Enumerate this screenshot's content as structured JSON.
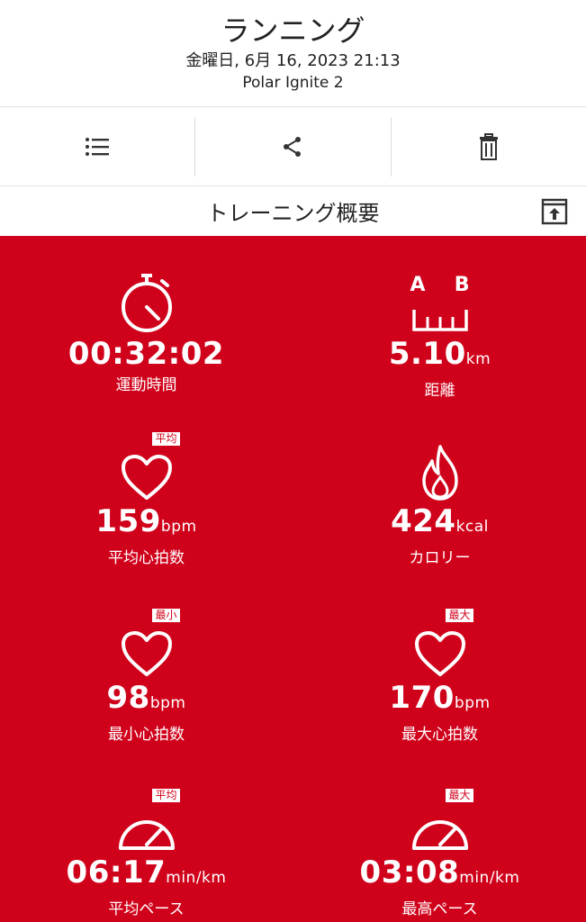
{
  "header": {
    "title": "ランニング",
    "subtitle": "金曜日, 6月 16, 2023 21:13",
    "device": "Polar Ignite 2"
  },
  "toolbar": {
    "icons": [
      "list-icon",
      "share-icon",
      "trash-icon"
    ]
  },
  "section": {
    "title": "トレーニング概要",
    "export_icon": "export-icon"
  },
  "stats": {
    "duration": {
      "value": "00:32:02",
      "unit": "",
      "label": "運動時間"
    },
    "distance": {
      "value": "5.10",
      "unit": "km",
      "label": "距離",
      "icon_labels": [
        "A",
        "B"
      ]
    },
    "avg_hr": {
      "value": "159",
      "unit": "bpm",
      "label": "平均心拍数",
      "badge": "平均"
    },
    "calories": {
      "value": "424",
      "unit": "kcal",
      "label": "カロリー"
    },
    "min_hr": {
      "value": "98",
      "unit": "bpm",
      "label": "最小心拍数",
      "badge": "最小"
    },
    "max_hr": {
      "value": "170",
      "unit": "bpm",
      "label": "最大心拍数",
      "badge": "最大"
    },
    "avg_pace": {
      "value": "06:17",
      "unit": "min/km",
      "label": "平均ペース",
      "badge": "平均"
    },
    "max_pace": {
      "value": "03:08",
      "unit": "min/km",
      "label": "最高ペース",
      "badge": "最大"
    }
  },
  "colors": {
    "accent": "#d0021b",
    "text": "#222222",
    "on_accent": "#ffffff"
  }
}
